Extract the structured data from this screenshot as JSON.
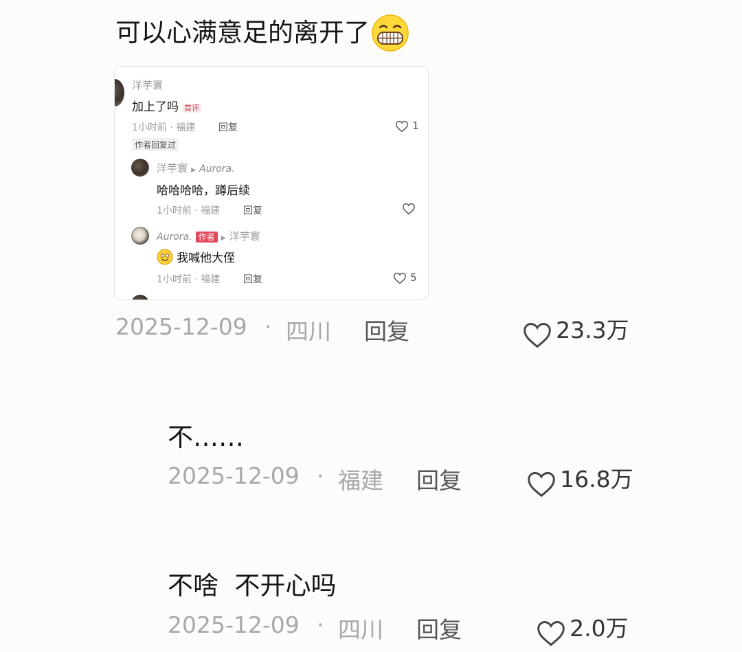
{
  "main_comment": {
    "text": "可以心满意足的离开了",
    "emoji": "grinning-face",
    "date": "2025-12-09",
    "separator": "·",
    "location": "四川",
    "reply_label": "回复",
    "likes": "23.3万"
  },
  "embedded_screenshot": {
    "comment1": {
      "username": "洋芋寰",
      "text": "加上了吗",
      "badge": "首评",
      "meta": "1小时前 · 福建",
      "reply_label": "回复",
      "likes": "1",
      "author_replied": "作者回复过"
    },
    "reply1": {
      "username": "洋芋寰",
      "reply_to": "Aurora.",
      "text": "哈哈哈哈，蹲后续",
      "meta": "1小时前 · 福建",
      "reply_label": "回复"
    },
    "reply2": {
      "username": "Aurora.",
      "author_badge": "作者",
      "reply_to": "洋芋寰",
      "text": "我喊他大侄",
      "meta": "1小时前 · 福建",
      "reply_label": "回复",
      "likes": "5"
    }
  },
  "replies": [
    {
      "text": "不……",
      "date": "2025-12-09",
      "separator": "·",
      "location": "福建",
      "reply_label": "回复",
      "likes": "16.8万"
    },
    {
      "text": "不啥  不开心吗",
      "date": "2025-12-09",
      "separator": "·",
      "location": "四川",
      "reply_label": "回复",
      "likes": "2.0万"
    }
  ],
  "colors": {
    "background": "#fcfcfb",
    "meta_gray": "#a8a8a8",
    "author_badge": "#e24a5c"
  }
}
